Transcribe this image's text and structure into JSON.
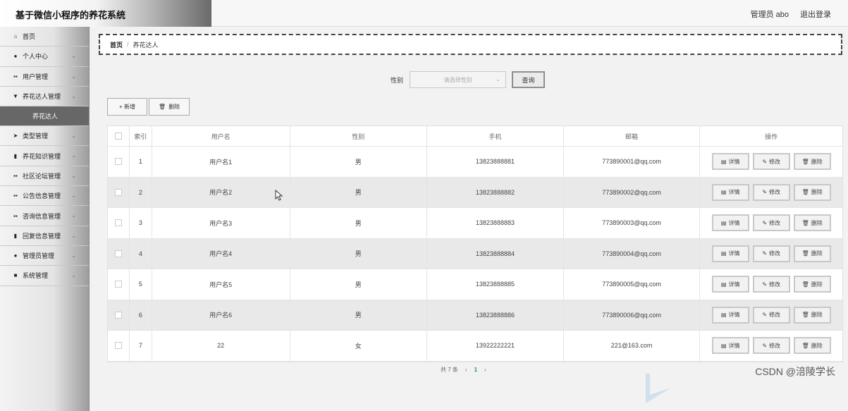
{
  "header": {
    "title": "基于微信小程序的养花系统",
    "user": "管理员 abo",
    "logout": "退出登录"
  },
  "sidebar": {
    "items": [
      {
        "label": "首页",
        "icon": "home-icon"
      },
      {
        "label": "个人中心",
        "icon": "user-icon"
      },
      {
        "label": "用户管理",
        "icon": "grid-icon"
      },
      {
        "label": "养花达人管理",
        "icon": "funnel-icon"
      },
      {
        "label": "类型管理",
        "icon": "send-icon"
      },
      {
        "label": "养花知识管理",
        "icon": "clipboard-icon"
      },
      {
        "label": "社区论坛管理",
        "icon": "grid-icon"
      },
      {
        "label": "公告信息管理",
        "icon": "grid-icon"
      },
      {
        "label": "咨询信息管理",
        "icon": "grid-icon"
      },
      {
        "label": "回复信息管理",
        "icon": "bar-chart-icon"
      },
      {
        "label": "管理员管理",
        "icon": "user-icon"
      },
      {
        "label": "系统管理",
        "icon": "document-icon"
      }
    ],
    "active_sub": "养花达人"
  },
  "breadcrumb": {
    "home": "首页",
    "sep": "/",
    "current": "养花达人"
  },
  "search": {
    "label": "性别",
    "placeholder": "请选择性别",
    "button": "查询"
  },
  "actions": {
    "add": "+ 新增",
    "delete": "删除"
  },
  "table": {
    "headers": [
      "索引",
      "用户名",
      "性别",
      "手机",
      "邮箱",
      "操作"
    ],
    "rows": [
      {
        "idx": "1",
        "user": "用户名1",
        "sex": "男",
        "phone": "13823888881",
        "mail": "773890001@qq.com"
      },
      {
        "idx": "2",
        "user": "用户名2",
        "sex": "男",
        "phone": "13823888882",
        "mail": "773890002@qq.com"
      },
      {
        "idx": "3",
        "user": "用户名3",
        "sex": "男",
        "phone": "13823888883",
        "mail": "773890003@qq.com"
      },
      {
        "idx": "4",
        "user": "用户名4",
        "sex": "男",
        "phone": "13823888884",
        "mail": "773890004@qq.com"
      },
      {
        "idx": "5",
        "user": "用户名5",
        "sex": "男",
        "phone": "13823888885",
        "mail": "773890005@qq.com"
      },
      {
        "idx": "6",
        "user": "用户名6",
        "sex": "男",
        "phone": "13823888886",
        "mail": "773890006@qq.com"
      },
      {
        "idx": "7",
        "user": "22",
        "sex": "女",
        "phone": "13922222221",
        "mail": "221@163.com"
      }
    ],
    "ops": {
      "detail": "详情",
      "edit": "修改",
      "delete": "删除"
    }
  },
  "pager": {
    "total": "共 7 条",
    "prev": "‹",
    "page": "1",
    "next": "›"
  },
  "watermark": "CSDN @涪陵学长"
}
